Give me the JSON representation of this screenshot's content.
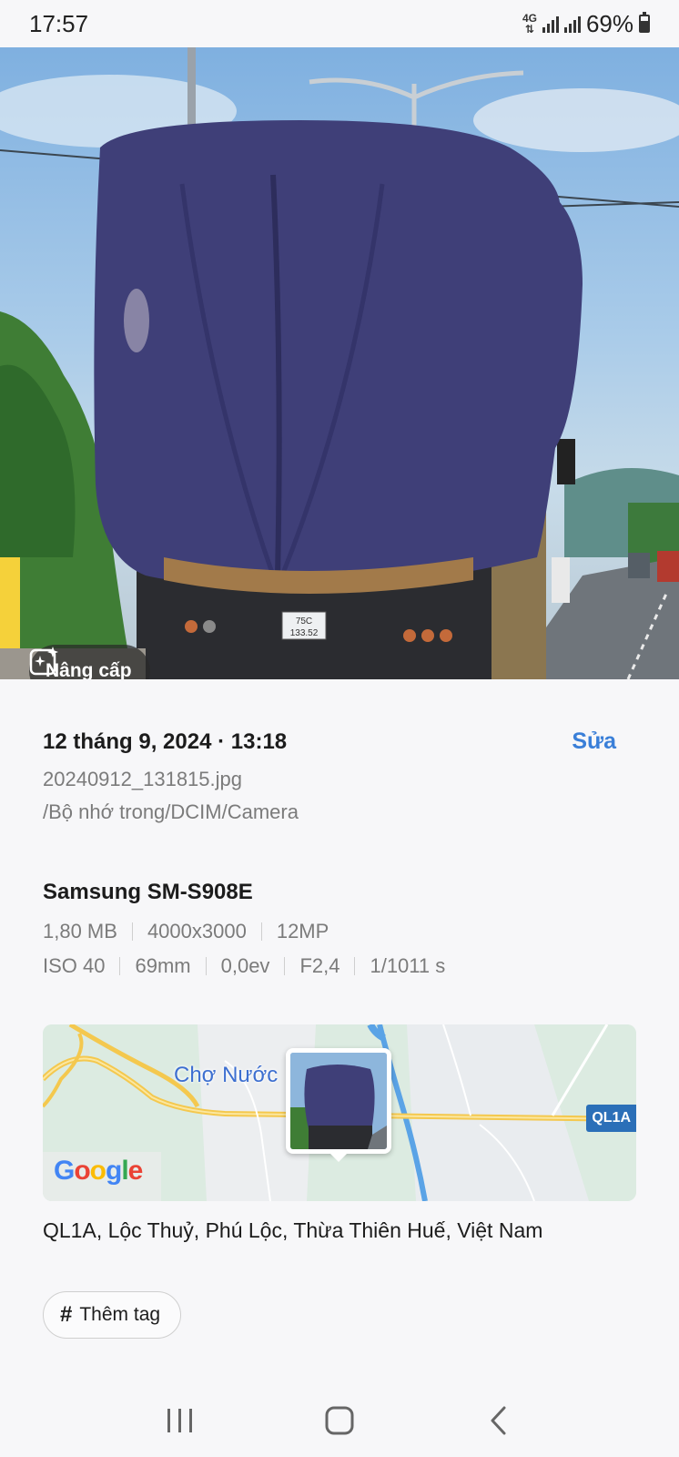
{
  "status_bar": {
    "time": "17:57",
    "network_type": "4G",
    "battery_percent": "69%",
    "battery_level": 0.69
  },
  "photo": {
    "upgrade_label": "Nâng cấp",
    "icon": "sparkle-image-icon"
  },
  "details": {
    "datetime": "12 tháng 9, 2024 · 13:18",
    "edit_label": "Sửa",
    "filename": "20240912_131815.jpg",
    "path": "/Bộ nhớ trong/DCIM/Camera"
  },
  "device": {
    "name": "Samsung SM-S908E",
    "file_specs": [
      "1,80 MB",
      "4000x3000",
      "12MP"
    ],
    "camera_specs": [
      "ISO 40",
      "69mm",
      "0,0ev",
      "F2,4",
      "1/1011 s"
    ]
  },
  "map": {
    "place_label": "Chợ Nước",
    "road_badge": "QL1A",
    "logo_letters": [
      "G",
      "o",
      "o",
      "g",
      "l",
      "e"
    ]
  },
  "location": {
    "address": "QL1A, Lộc Thuỷ, Phú Lộc, Thừa Thiên Huế, Việt Nam"
  },
  "tags": {
    "add_tag_label": "Thêm tag",
    "hash": "#"
  },
  "nav": {
    "recents": "recents-icon",
    "home": "home-icon",
    "back": "back-icon"
  },
  "colors": {
    "accent": "#3a7fd8",
    "tarp": "#3f3f78"
  }
}
